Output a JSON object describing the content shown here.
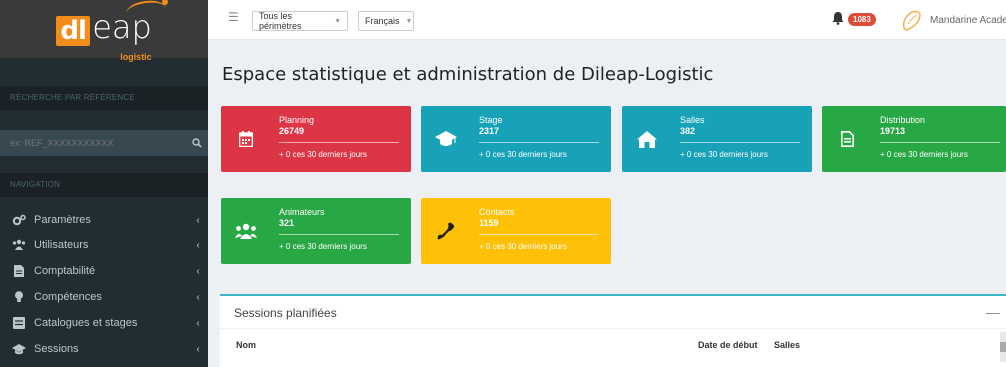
{
  "logo": {
    "box_text": "dl",
    "main_text": "eap",
    "sub_text": "logistic"
  },
  "sidebar": {
    "search_section_label": "RECHERCHE PAR RÉFÉRENCE",
    "search_placeholder": "ex: REF_XXXXXXXXXXX",
    "nav_section_label": "NAVIGATION",
    "items": [
      {
        "label": "Paramètres",
        "icon": "cogs-icon"
      },
      {
        "label": "Utilisateurs",
        "icon": "users-icon"
      },
      {
        "label": "Comptabilité",
        "icon": "document-icon"
      },
      {
        "label": "Compétences",
        "icon": "lightbulb-icon"
      },
      {
        "label": "Catalogues et stages",
        "icon": "book-icon"
      },
      {
        "label": "Sessions",
        "icon": "graduation-cap-icon"
      }
    ],
    "chevron": "‹"
  },
  "navbar": {
    "perimeter_select": "Tous les périmètres",
    "language_select": "Français",
    "notification_count": "1083",
    "user_name": "Mandarine Academy"
  },
  "page": {
    "title": "Espace statistique et administration de Dileap-Logistic"
  },
  "colors": {
    "red": "#dd4b39",
    "cyan": "#17a2b8",
    "green": "#28a745",
    "yellow": "#ffc107",
    "sidebar": "#222d32",
    "accent_orange": "#f28c1b"
  },
  "stats": [
    {
      "title": "Planning",
      "value": "26749",
      "footer": "+ 0 ces 30 derniers jours",
      "icon": "calendar-icon"
    },
    {
      "title": "Stage",
      "value": "2317",
      "footer": "+ 0 ces 30 derniers jours",
      "icon": "graduation-cap-icon"
    },
    {
      "title": "Salles",
      "value": "382",
      "footer": "+ 0 ces 30 derniers jours",
      "icon": "home-icon"
    },
    {
      "title": "Distribution",
      "value": "19713",
      "footer": "+ 0 ces 30 derniers jours",
      "icon": "file-icon"
    },
    {
      "title": "Animateurs",
      "value": "321",
      "footer": "+ 0 ces 30 derniers jours",
      "icon": "users-icon"
    },
    {
      "title": "Contacts",
      "value": "1159",
      "footer": "+ 0 ces 30 derniers jours",
      "icon": "phone-icon"
    }
  ],
  "sessions_panel": {
    "title": "Sessions planifiées",
    "columns": [
      "Nom",
      "Date de début",
      "Salles"
    ]
  }
}
